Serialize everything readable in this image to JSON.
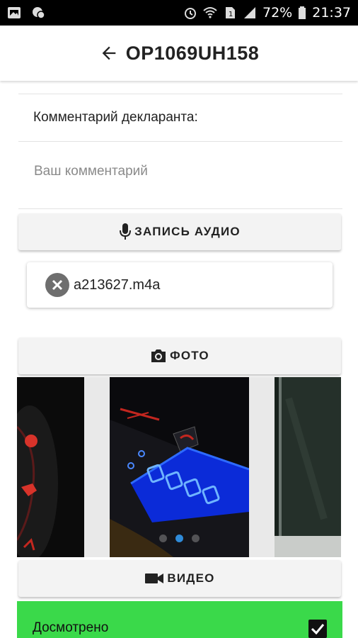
{
  "status_bar": {
    "battery": "72%",
    "time": "21:37",
    "icons": [
      "image-icon",
      "chat-icon",
      "alarm-icon",
      "wifi-icon",
      "sim-icon",
      "signal-icon",
      "battery-icon"
    ]
  },
  "app_bar": {
    "back_icon": "arrow-left-icon",
    "title": "OP1069UH158"
  },
  "comment": {
    "label": "Комментарий декларанта:",
    "placeholder": "Ваш комментарий",
    "value": ""
  },
  "audio": {
    "button_label": "ЗАПИСЬ АУДИО",
    "icon": "microphone-icon",
    "files": [
      {
        "name": "a213627.m4a",
        "remove_icon": "close-circle-icon"
      }
    ]
  },
  "photo": {
    "button_label": "ФОТО",
    "icon": "camera-icon",
    "pager": {
      "count": 3,
      "active_index": 1
    }
  },
  "video": {
    "button_label": "ВИДЕО",
    "icon": "videocam-icon"
  },
  "viewed": {
    "label": "Досмотрено",
    "checked": true
  },
  "colors": {
    "accent_green": "#3ad94a",
    "pager_active": "#2f8bd9",
    "button_bg": "#f3f3f3"
  }
}
